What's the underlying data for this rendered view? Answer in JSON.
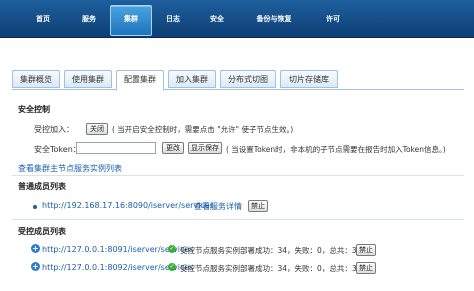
{
  "topnav": {
    "items": [
      {
        "label": "首页"
      },
      {
        "label": "服务"
      },
      {
        "label": "集群"
      },
      {
        "label": "日志"
      },
      {
        "label": "安全"
      },
      {
        "label": "备份与恢复"
      },
      {
        "label": "许可"
      }
    ],
    "active": "集群"
  },
  "tabs": [
    {
      "label": "集群概览"
    },
    {
      "label": "使用集群"
    },
    {
      "label": "配置集群"
    },
    {
      "label": "加入集群"
    },
    {
      "label": "分布式切图"
    },
    {
      "label": "切片存储库"
    }
  ],
  "security": {
    "title": "安全控制",
    "controlled_join_label": "受控加入：",
    "close_button": "关闭",
    "close_note": "( 当开启安全控制时，需要点击 \"允许\" 使子节点生效。)",
    "token_label": "安全Token：",
    "token_value": "",
    "change_button": "更改",
    "save_button": "显示保存",
    "token_note": "( 当设置Token时，非本机的子节点需要在报告时加入Token信息。)",
    "view_link": "查看集群主节点服务实例列表"
  },
  "normal_members": {
    "title": "普通成员列表",
    "items": [
      {
        "url": "http://192.168.17.16:8090/iserver/services",
        "detail_link": "查看服务详情",
        "action": "禁止"
      }
    ]
  },
  "controlled_members": {
    "title": "受控成员列表",
    "items": [
      {
        "url": "http://127.0.0.1:8091/iserver/services",
        "status": "受控节点服务实例部署成功：34，失败：0，总共：34",
        "action": "禁止"
      },
      {
        "url": "http://127.0.0.1:8092/iserver/services",
        "status": "受控节点服务实例部署成功：34，失败：0，总共：34",
        "action": "禁止"
      }
    ]
  },
  "colors": {
    "nav_bg": "#0c3f74",
    "nav_active": "#2b86cf",
    "link": "#1a5ea8",
    "ok": "#3cae3c"
  }
}
